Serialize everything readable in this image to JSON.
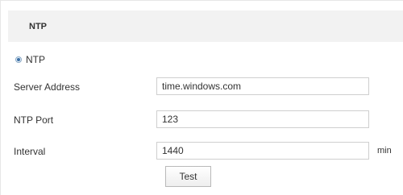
{
  "section": {
    "title": "NTP"
  },
  "mode_radio": {
    "label": "NTP",
    "selected": true
  },
  "fields": {
    "server_address": {
      "label": "Server Address",
      "value": "time.windows.com"
    },
    "ntp_port": {
      "label": "NTP Port",
      "value": "123"
    },
    "interval": {
      "label": "Interval",
      "value": "1440",
      "unit": "min"
    }
  },
  "buttons": {
    "test_label": "Test"
  }
}
